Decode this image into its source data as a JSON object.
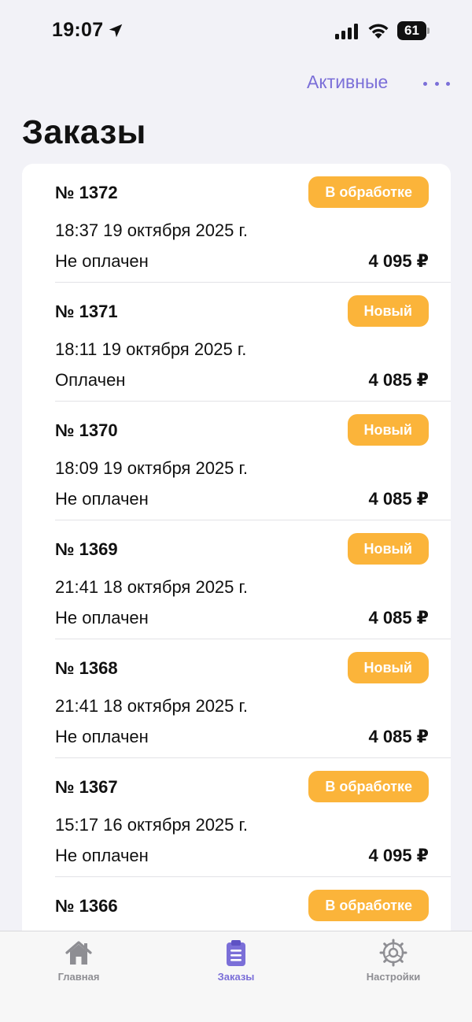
{
  "status_bar": {
    "time": "19:07",
    "battery": "61"
  },
  "nav": {
    "filter_label": "Активные"
  },
  "page": {
    "title": "Заказы"
  },
  "colors": {
    "accent": "#7b6fd8",
    "badge": "#fbb43a",
    "inactive": "#8e8e93"
  },
  "orders": [
    {
      "number": "№ 1372",
      "datetime": "18:37  19 октября 2025 г.",
      "payment": "Не оплачен",
      "total": "4 095 ₽",
      "status": "В обработке"
    },
    {
      "number": "№ 1371",
      "datetime": "18:11  19 октября 2025 г.",
      "payment": "Оплачен",
      "total": "4 085 ₽",
      "status": "Новый"
    },
    {
      "number": "№ 1370",
      "datetime": "18:09  19 октября 2025 г.",
      "payment": "Не оплачен",
      "total": "4 085 ₽",
      "status": "Новый"
    },
    {
      "number": "№ 1369",
      "datetime": "21:41  18 октября 2025 г.",
      "payment": "Не оплачен",
      "total": "4 085 ₽",
      "status": "Новый"
    },
    {
      "number": "№ 1368",
      "datetime": "21:41  18 октября 2025 г.",
      "payment": "Не оплачен",
      "total": "4 085 ₽",
      "status": "Новый"
    },
    {
      "number": "№ 1367",
      "datetime": "15:17  16 октября 2025 г.",
      "payment": "Не оплачен",
      "total": "4 095 ₽",
      "status": "В обработке"
    },
    {
      "number": "№ 1366",
      "status": "В обработке"
    }
  ],
  "tabs": [
    {
      "label": "Главная",
      "icon": "house-icon"
    },
    {
      "label": "Заказы",
      "icon": "clipboard-icon"
    },
    {
      "label": "Настройки",
      "icon": "gear-icon"
    }
  ]
}
